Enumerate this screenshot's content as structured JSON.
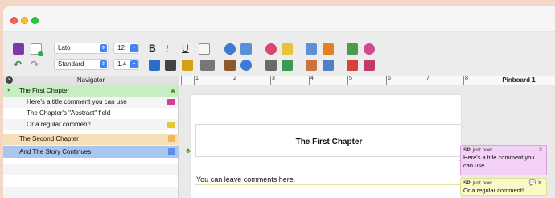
{
  "toolbar": {
    "font_family": "Lato",
    "font_size": "12",
    "paragraph_style": "Standard",
    "line_spacing": "1.4",
    "bold": "B",
    "italic": "i",
    "underline": "U"
  },
  "navigator": {
    "title": "Navigator",
    "items": [
      {
        "label": "The First Chapter",
        "level": 0,
        "highlight": "#c6eec0",
        "icon": "character-icon"
      },
      {
        "label": "Here's a title comment you can use",
        "level": 1,
        "highlight": "",
        "icon": "comment-pink-icon"
      },
      {
        "label": "The Chapter's \"Abstract\" field",
        "level": 1,
        "highlight": "",
        "icon": ""
      },
      {
        "label": "Or a regular comment!",
        "level": 1,
        "highlight": "",
        "icon": "comment-yellow-icon"
      },
      {
        "label": "The Second Chapter",
        "level": 0,
        "highlight": "#f6deb8",
        "icon": "orange-tag-icon"
      },
      {
        "label": "And The Story Continues",
        "level": 0,
        "highlight": "#a7c7f1",
        "icon": "blue-tag-icon"
      }
    ]
  },
  "ruler": {
    "numbers": [
      "1",
      "2",
      "3",
      "4",
      "5",
      "6",
      "7",
      "8"
    ],
    "pinboard_label": "Pinboard 1"
  },
  "editor": {
    "chapter_title": "The First Chapter",
    "body_text": "You can leave comments here."
  },
  "comments": [
    {
      "author": "SP",
      "time": "just now",
      "text": "Here's a title comment you can use",
      "color": "#f3d1f6"
    },
    {
      "author": "SP",
      "time": "just now",
      "text": "Or a regular comment!",
      "color": "#fbf8c8"
    }
  ]
}
